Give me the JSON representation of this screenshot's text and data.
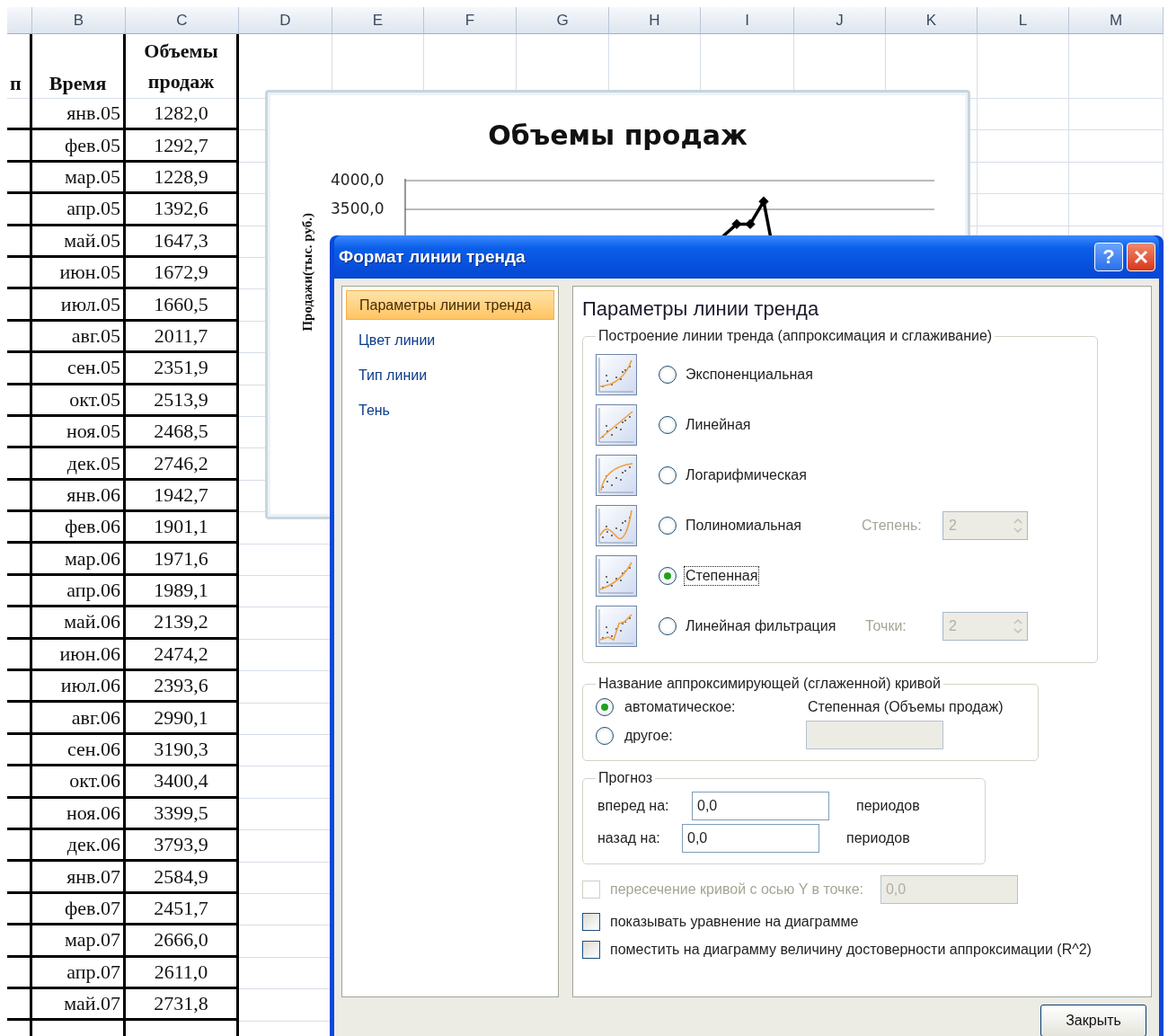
{
  "sheet": {
    "columns": [
      "B",
      "C",
      "D",
      "E",
      "F",
      "G",
      "H",
      "I",
      "J",
      "K",
      "L",
      "M"
    ],
    "column_a_fragment": "п",
    "headers": [
      "Время",
      "Объемы продаж"
    ],
    "rows": [
      {
        "time": "янв.05",
        "sales": "1282,0"
      },
      {
        "time": "фев.05",
        "sales": "1292,7"
      },
      {
        "time": "мар.05",
        "sales": "1228,9"
      },
      {
        "time": "апр.05",
        "sales": "1392,6"
      },
      {
        "time": "май.05",
        "sales": "1647,3"
      },
      {
        "time": "июн.05",
        "sales": "1672,9"
      },
      {
        "time": "июл.05",
        "sales": "1660,5"
      },
      {
        "time": "авг.05",
        "sales": "2011,7"
      },
      {
        "time": "сен.05",
        "sales": "2351,9"
      },
      {
        "time": "окт.05",
        "sales": "2513,9"
      },
      {
        "time": "ноя.05",
        "sales": "2468,5"
      },
      {
        "time": "дек.05",
        "sales": "2746,2"
      },
      {
        "time": "янв.06",
        "sales": "1942,7"
      },
      {
        "time": "фев.06",
        "sales": "1901,1"
      },
      {
        "time": "мар.06",
        "sales": "1971,6"
      },
      {
        "time": "апр.06",
        "sales": "1989,1"
      },
      {
        "time": "май.06",
        "sales": "2139,2"
      },
      {
        "time": "июн.06",
        "sales": "2474,2"
      },
      {
        "time": "июл.06",
        "sales": "2393,6"
      },
      {
        "time": "авг.06",
        "sales": "2990,1"
      },
      {
        "time": "сен.06",
        "sales": "3190,3"
      },
      {
        "time": "окт.06",
        "sales": "3400,4"
      },
      {
        "time": "ноя.06",
        "sales": "3399,5"
      },
      {
        "time": "дек.06",
        "sales": "3793,9"
      },
      {
        "time": "янв.07",
        "sales": "2584,9"
      },
      {
        "time": "фев.07",
        "sales": "2451,7"
      },
      {
        "time": "мар.07",
        "sales": "2666,0"
      },
      {
        "time": "апр.07",
        "sales": "2611,0"
      },
      {
        "time": "май.07",
        "sales": "2731,8"
      }
    ]
  },
  "chart": {
    "title": "Объемы продаж",
    "ylabel": "Продажи(тыс. руб.)",
    "yticks": [
      "4000,0",
      "3500,0"
    ]
  },
  "dialog": {
    "title": "Формат линии тренда",
    "help_button": "?",
    "nav": [
      {
        "label": "Параметры линии тренда",
        "selected": true
      },
      {
        "label": "Цвет линии",
        "selected": false
      },
      {
        "label": "Тип линии",
        "selected": false
      },
      {
        "label": "Тень",
        "selected": false
      }
    ],
    "panel_title": "Параметры линии тренда",
    "trend_group": {
      "legend": "Построение линии тренда (аппроксимация и сглаживание)",
      "options": [
        {
          "kind": "exponential",
          "label": "Экспоненциальная",
          "selected": false
        },
        {
          "kind": "linear",
          "label": "Линейная",
          "selected": false
        },
        {
          "kind": "logarithmic",
          "label": "Логарифмическая",
          "selected": false
        },
        {
          "kind": "polynomial",
          "label": "Полиномиальная",
          "selected": false,
          "param": {
            "label": "Степень:",
            "value": "2",
            "disabled": true
          }
        },
        {
          "kind": "power",
          "label": "Степенная",
          "selected": true,
          "focused": true
        },
        {
          "kind": "moving_average",
          "label": "Линейная фильтрация",
          "selected": false,
          "param": {
            "label": "Точки:",
            "value": "2",
            "disabled": true
          }
        }
      ]
    },
    "name_group": {
      "legend": "Название аппроксимирующей (сглаженной) кривой",
      "options": [
        {
          "label": "автоматическое:",
          "selected": true
        },
        {
          "label": "другое:",
          "selected": false
        }
      ],
      "auto_name": "Степенная (Объемы продаж)",
      "custom_field": {
        "disabled": true
      }
    },
    "forecast": {
      "legend": "Прогноз",
      "rows": [
        {
          "label": "вперед на:",
          "value": "0,0",
          "unit": "периодов"
        },
        {
          "label": "назад на:",
          "value": "0,0",
          "unit": "периодов"
        }
      ]
    },
    "checks": [
      {
        "label": "пересечение кривой с осью Y в точке:",
        "checked": false,
        "disabled": true,
        "field": {
          "value": "0,0",
          "disabled": true
        }
      },
      {
        "label": "показывать уравнение на диаграмме",
        "checked": false,
        "disabled": false
      },
      {
        "label": "поместить на диаграмму величину достоверности аппроксимации (R^2)",
        "checked": false,
        "disabled": false
      }
    ],
    "buttons": [
      {
        "label": "Закрыть"
      }
    ]
  }
}
